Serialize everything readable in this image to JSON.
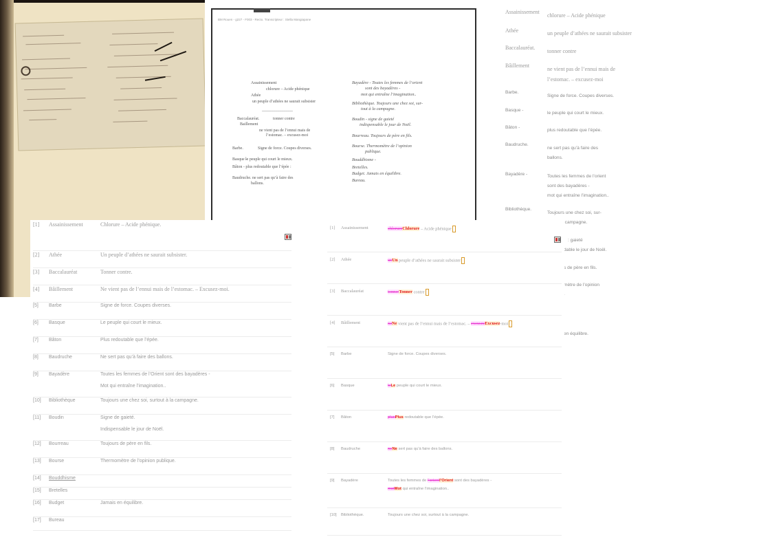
{
  "transcription_sheet": {
    "header": "BM Rouen - g227 - F003 - Recto. Transcripteur : Stella Mangiapane",
    "left_column": [
      "Assainissement",
      "chlorure – Acide phénique",
      "Athée",
      "un peuple d’athées ne saurait subsister",
      "_______________",
      "Baccalauréat.",
      "tonner contre",
      "Baillement",
      "ne vient pas de l’ennui mais de",
      "l’estomac. – excusez-moi",
      "Barbe.",
      "Signe de force. Coupes diverses.",
      "Basque -",
      "le peuple qui court le mieux.",
      "Bâton - plus redoutable que l’épée :",
      "Baudruche. ne sert pas qu’à faire des",
      "ballons."
    ],
    "right_column": [
      "Bayadère - Toutes les femmes de l’orient",
      "sont des bayadères -",
      "mot qui entraîne l’imagination..",
      "Bibliothèque. Toujours une chez soi, sur-",
      "tout à la campagne.",
      "Boudin - signe de gaieté",
      "indispensable le jour de Noël.",
      "Bourreau. Toujours de père en fils.",
      "Bourse. Thermomètre de l’opinion",
      "publique.",
      "Bouddhisme -",
      "Bretelles.",
      "Budget. Jamais en équilibre.",
      "Bureau."
    ]
  },
  "right_glossary": [
    {
      "term": "Assainissement",
      "def": "chlorure – Acide phénique"
    },
    {
      "term": "Athée",
      "def": "un peuple d’athées ne saurait subsister"
    },
    {
      "term": "Baccalauréat.",
      "def": "tonner contre"
    },
    {
      "term": "Bâillement",
      "def": "ne vient pas de l’ennui mais de"
    },
    {
      "term": "",
      "def": "l’estomac. – excusez-moi"
    },
    {
      "term": "Barbe.",
      "def": "Signe de force. Coupes diverses."
    },
    {
      "term": "Basque -",
      "def": "le peuple qui court le mieux."
    },
    {
      "term": "Bâton -",
      "def": "plus redoutable que l’épée."
    },
    {
      "term": "Baudruche.",
      "def": "ne sert pas qu’à faire des"
    },
    {
      "term": "",
      "def": "ballons."
    },
    {
      "term": "Bayadère -",
      "def": "Toutes les femmes de l’orient"
    },
    {
      "term": "",
      "def": "sont des bayadères -"
    },
    {
      "term": "",
      "def": "mot qui entraîne l’imagination.."
    },
    {
      "term": "Bibliothèque.",
      "def": "Toujours une chez soi, sur-"
    },
    {
      "term": "",
      "def": ": campagne."
    },
    {
      "term": "",
      "def": ": gaieté"
    },
    {
      "term": "",
      "def": "dable le jour de Noël."
    },
    {
      "term": "",
      "def": "s de père en fils."
    },
    {
      "term": "",
      "def": "mètre de l’opinion"
    },
    {
      "term": "",
      "def": "."
    },
    {
      "term": "",
      "def": "en équilibre."
    }
  ],
  "list": [
    {
      "num": "[1]",
      "term": "Assainissement",
      "def": [
        "Chlorure – Acide phénique."
      ]
    },
    {
      "num": "[2]",
      "term": "Athée",
      "def": [
        "Un peuple d’athées ne saurait subsister."
      ]
    },
    {
      "num": "[3]",
      "term": "Baccalauréat",
      "def": [
        "Tonner contre."
      ]
    },
    {
      "num": "[4]",
      "term": "Bâillement",
      "def": [
        "Ne vient pas de l’ennui mais de l’estomac. – Excusez-moi."
      ]
    },
    {
      "num": "[5]",
      "term": "Barbe",
      "def": [
        "Signe de force. Coupes diverses."
      ]
    },
    {
      "num": "[6]",
      "term": "Basque",
      "def": [
        "Le peuple qui court le mieux."
      ]
    },
    {
      "num": "[7]",
      "term": "Bâton",
      "def": [
        "Plus redoutable que l’épée."
      ]
    },
    {
      "num": "[8]",
      "term": "Baudruche",
      "def": [
        "Ne sert pas qu’à faire des ballons."
      ]
    },
    {
      "num": "[9]",
      "term": "Bayadère",
      "def": [
        "Toutes les femmes de l’Orient sont des bayadères -",
        "Mot qui entraîne l’imagination.."
      ]
    },
    {
      "num": "[10]",
      "term": "Bibliothèque",
      "def": [
        "Toujours une chez soi, surtout à la campagne."
      ]
    },
    {
      "num": "[11]",
      "term": "Boudin",
      "def": [
        "Signe de gaieté.",
        "Indispensable le jour de Noël."
      ]
    },
    {
      "num": "[12]",
      "term": "Bourreau",
      "def": [
        "Toujours de père en fils."
      ]
    },
    {
      "num": "[13]",
      "term": "Bourse",
      "def": [
        "Thermomètre de l’opinion publique."
      ]
    },
    {
      "num": "[14]",
      "term": "Bouddhisme",
      "def": []
    },
    {
      "num": "[15]",
      "term": "Bretelles",
      "def": []
    },
    {
      "num": "[16]",
      "term": "Budget",
      "def": [
        "Jamais en équilibre."
      ]
    },
    {
      "num": "[17]",
      "term": "Bureau",
      "def": []
    }
  ],
  "diff": [
    {
      "num": "[1]",
      "term": "Assainissement",
      "parts": [
        {
          "t": "chlorure",
          "k": "del"
        },
        {
          "t": "Chlorure",
          "k": "ins"
        },
        {
          "t": " – Acide phénique",
          "k": ""
        }
      ]
    },
    {
      "num": "[2]",
      "term": "Athée",
      "parts": [
        {
          "t": "un",
          "k": "del"
        },
        {
          "t": "Un",
          "k": "ins"
        },
        {
          "t": " peuple d’athées ne saurait subsister",
          "k": ""
        }
      ]
    },
    {
      "num": "[3]",
      "term": "Baccalauréat",
      "parts": [
        {
          "t": "tonner",
          "k": "del"
        },
        {
          "t": "Tonner",
          "k": "ins"
        },
        {
          "t": " contre",
          "k": ""
        }
      ]
    },
    {
      "num": "[4]",
      "term": "Bâillement",
      "parts": [
        {
          "t": "ne",
          "k": "del"
        },
        {
          "t": "Ne",
          "k": "ins"
        },
        {
          "t": " vient pas de l’ennui mais de l’estomac. – ",
          "k": ""
        },
        {
          "t": "excusez",
          "k": "del"
        },
        {
          "t": "Excusez",
          "k": "ins"
        },
        {
          "t": "-moi",
          "k": ""
        }
      ]
    },
    {
      "num": "[5]",
      "term": "Barbe",
      "parts": [
        {
          "t": "Signe de force. Coupes diverses.",
          "k": ""
        }
      ]
    },
    {
      "num": "[6]",
      "term": "Basque",
      "parts": [
        {
          "t": "le",
          "k": "del"
        },
        {
          "t": "Le",
          "k": "ins"
        },
        {
          "t": " peuple qui court le mieux.",
          "k": ""
        }
      ]
    },
    {
      "num": "[7]",
      "term": "Bâton",
      "parts": [
        {
          "t": "plus",
          "k": "del"
        },
        {
          "t": "Plus",
          "k": "ins"
        },
        {
          "t": " redoutable que l’épée.",
          "k": ""
        }
      ]
    },
    {
      "num": "[8]",
      "term": "Baudruche",
      "parts": [
        {
          "t": "ne",
          "k": "del"
        },
        {
          "t": "Ne",
          "k": "ins"
        },
        {
          "t": " sert pas qu’à faire des ballons.",
          "k": ""
        }
      ]
    },
    {
      "num": "[9]",
      "term": "Bayadère",
      "parts": [
        {
          "t": "Toutes les femmes de ",
          "k": ""
        },
        {
          "t": "l’orient",
          "k": "del"
        },
        {
          "t": "l’Orient",
          "k": "ins"
        },
        {
          "t": " sont des bayadères -",
          "k": ""
        }
      ],
      "parts2": [
        {
          "t": "mot",
          "k": "del"
        },
        {
          "t": "Mot",
          "k": "ins"
        },
        {
          "t": " qui entraîne l’imagination..",
          "k": ""
        }
      ]
    },
    {
      "num": "[10]",
      "term": "Bibliothèque.",
      "parts": [
        {
          "t": "Toujours une chez soi, surtout à la campagne.",
          "k": ""
        }
      ]
    }
  ],
  "icons": {
    "book": "book-icon"
  }
}
